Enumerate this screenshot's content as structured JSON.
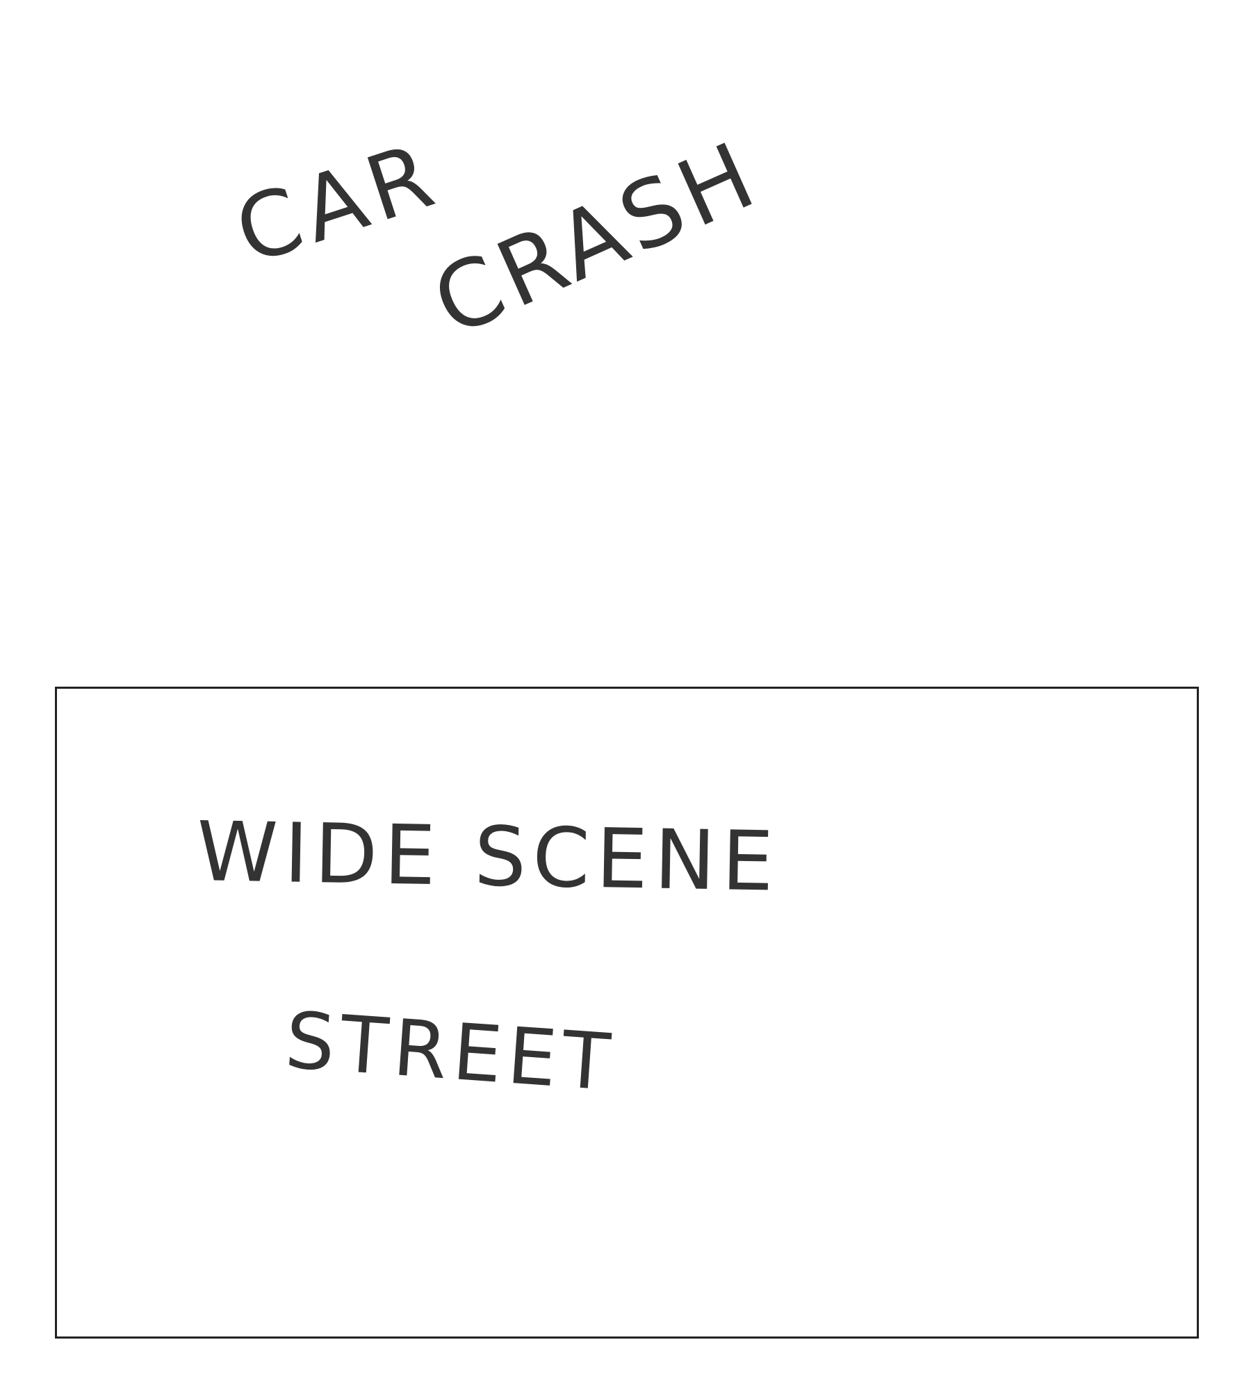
{
  "notes": {
    "car": "CAR",
    "crash": "CRASH"
  },
  "panel": {
    "line1": "WIDE SCENE",
    "line2": "STREET"
  },
  "colors": {
    "ink": "#333333",
    "border": "#222222",
    "background": "#ffffff"
  }
}
